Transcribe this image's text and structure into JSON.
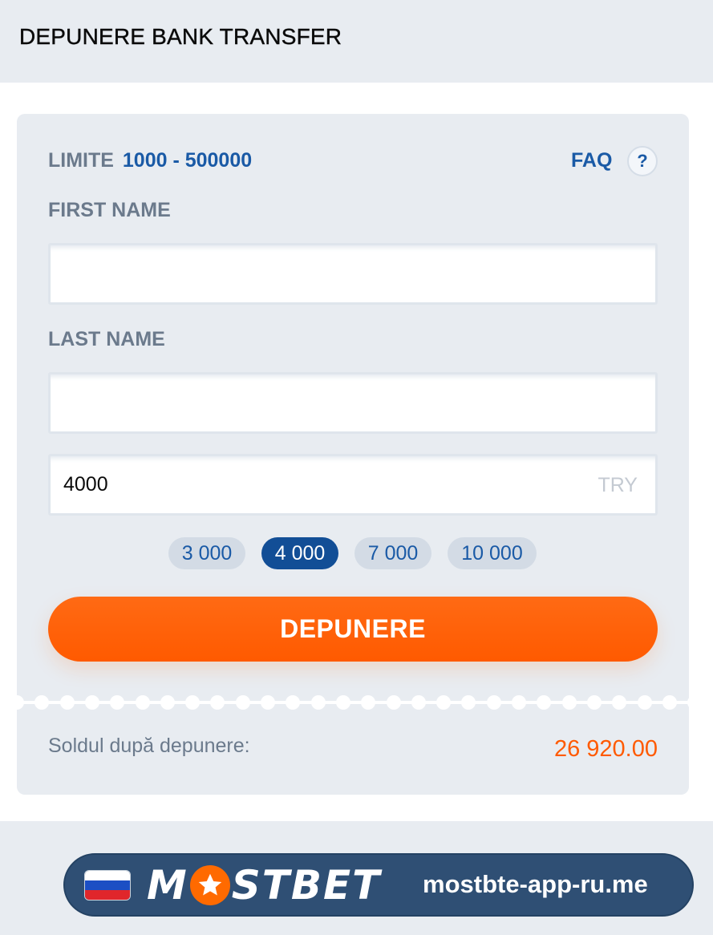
{
  "header": {
    "title": "DEPUNERE BANK TRANSFER"
  },
  "limits": {
    "label": "LIMITE",
    "value": "1000 - 500000"
  },
  "faq": {
    "label": "FAQ",
    "icon": "question-icon",
    "glyph": "?"
  },
  "form": {
    "first_name": {
      "label": "FIRST NAME",
      "value": ""
    },
    "last_name": {
      "label": "LAST NAME",
      "value": ""
    },
    "amount": {
      "value": "4000",
      "currency": "TRY"
    }
  },
  "quick_amounts": [
    {
      "label": "3 000",
      "selected": false
    },
    {
      "label": "4 000",
      "selected": true
    },
    {
      "label": "7 000",
      "selected": false
    },
    {
      "label": "10 000",
      "selected": false
    }
  ],
  "submit": {
    "label": "DEPUNERE"
  },
  "balance": {
    "label": "Soldul după depunere:",
    "value": "26 920.00"
  },
  "banner": {
    "flag": "russia-flag-icon",
    "brand": "MOSTBET",
    "site": "mostbte-app-ru.me"
  },
  "colors": {
    "accent_blue": "#1a5aa6",
    "selected_chip": "#124e96",
    "primary_orange": "#ff5a00",
    "muted_text": "#6b7a8c",
    "panel_bg": "#e8ecf1",
    "banner_bg": "#2f4f74"
  }
}
